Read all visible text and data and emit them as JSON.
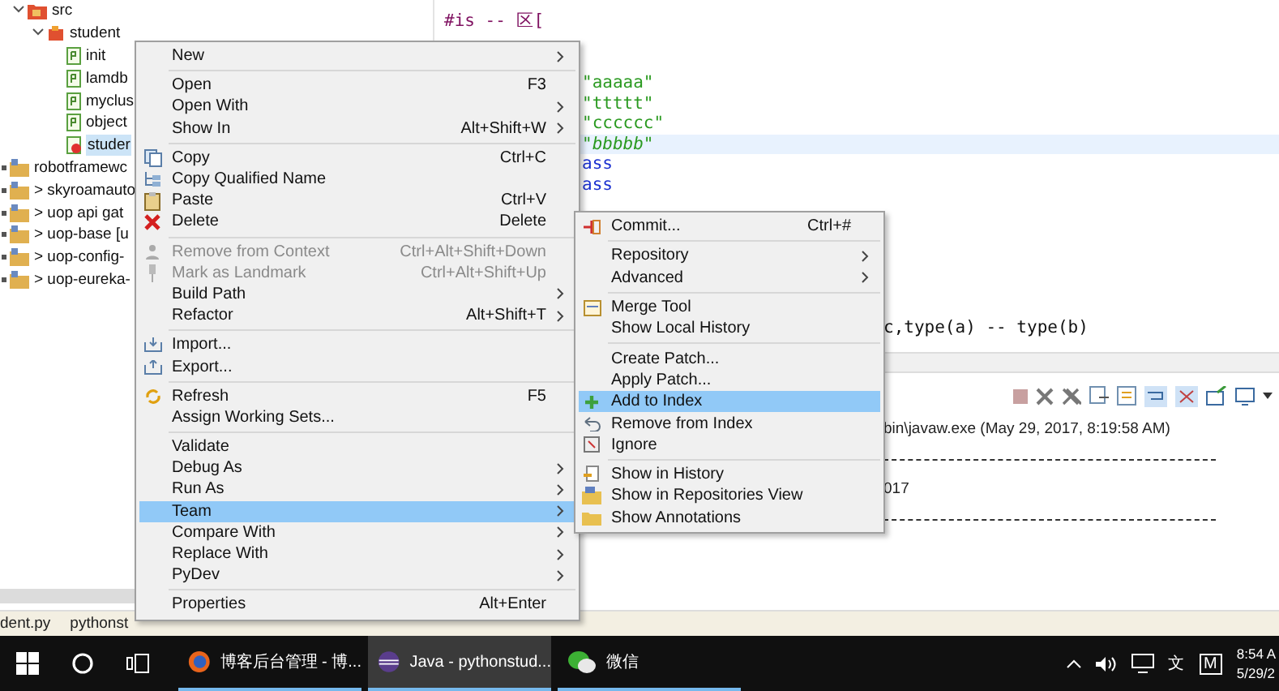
{
  "tree": {
    "items": [
      {
        "label": "src",
        "expanded": true,
        "children": [
          {
            "label": "student",
            "expanded": true,
            "selected": false,
            "children": [
              {
                "label": "init",
                "selected": false
              },
              {
                "label": "lamdb",
                "selected": false
              },
              {
                "label": "myclus",
                "selected": false
              },
              {
                "label": "object",
                "selected": false
              },
              {
                "label": "studer",
                "selected": true
              }
            ]
          }
        ]
      },
      {
        "label": "robotframewc",
        "selected": false
      },
      {
        "label": "> skyroamauto",
        "selected": false
      },
      {
        "label": "> uop api gat",
        "selected": false
      },
      {
        "label": "> uop-base [u",
        "selected": false
      },
      {
        "label": "> uop-config-",
        "selected": false
      },
      {
        "label": "> uop-eureka-",
        "selected": false
      }
    ]
  },
  "editor": {
    "lines": [
      {
        "text": "#is -- 区[",
        "kind": "comment",
        "current": false
      },
      {
        "text": "\"aaaaa\"",
        "kind": "string",
        "current": false
      },
      {
        "text": "\"ttttt\"",
        "kind": "string",
        "current": false
      },
      {
        "text": "\"cccccc\"",
        "kind": "string",
        "current": false
      },
      {
        "text": "\"bbbbb\"",
        "kind": "string",
        "current": true
      },
      {
        "text": "ass",
        "kind": "keyword",
        "current": false
      },
      {
        "text": "ass",
        "kind": "keyword",
        "current": false
      },
      {
        "text": "c,type(a) -- type(b)",
        "kind": "plain",
        "current": false
      }
    ]
  },
  "console": {
    "lines": [
      "bin\\javaw.exe (May 29, 2017, 8:19:58 AM)",
      "017"
    ]
  },
  "status_bar": {
    "items": [
      "dent.py",
      "pythonst"
    ]
  },
  "context_menu": {
    "groups": [
      [
        {
          "label": "New",
          "submenu": true,
          "disabled": false,
          "selected": false
        }
      ],
      [
        {
          "label": "Open",
          "shortcut": "F3",
          "submenu": false,
          "disabled": false,
          "selected": false
        },
        {
          "label": "Open With",
          "submenu": true,
          "disabled": false,
          "selected": false
        },
        {
          "label": "Show In",
          "shortcut": "Alt+Shift+W",
          "submenu": true,
          "disabled": false,
          "selected": false
        }
      ],
      [
        {
          "label": "Copy",
          "shortcut": "Ctrl+C",
          "submenu": false,
          "disabled": false,
          "selected": false
        },
        {
          "label": "Copy Qualified Name",
          "submenu": false,
          "disabled": false,
          "selected": false
        },
        {
          "label": "Paste",
          "shortcut": "Ctrl+V",
          "submenu": false,
          "disabled": false,
          "selected": false
        },
        {
          "label": "Delete",
          "shortcut": "Delete",
          "submenu": false,
          "disabled": false,
          "selected": false
        }
      ],
      [
        {
          "label": "Remove from Context",
          "shortcut": "Ctrl+Alt+Shift+Down",
          "submenu": false,
          "disabled": true,
          "selected": false
        },
        {
          "label": "Mark as Landmark",
          "shortcut": "Ctrl+Alt+Shift+Up",
          "submenu": false,
          "disabled": true,
          "selected": false
        },
        {
          "label": "Build Path",
          "submenu": true,
          "disabled": false,
          "selected": false
        },
        {
          "label": "Refactor",
          "shortcut": "Alt+Shift+T",
          "submenu": true,
          "disabled": false,
          "selected": false
        }
      ],
      [
        {
          "label": "Import...",
          "submenu": false,
          "disabled": false,
          "selected": false
        },
        {
          "label": "Export...",
          "submenu": false,
          "disabled": false,
          "selected": false
        }
      ],
      [
        {
          "label": "Refresh",
          "shortcut": "F5",
          "submenu": false,
          "disabled": false,
          "selected": false
        },
        {
          "label": "Assign Working Sets...",
          "submenu": false,
          "disabled": false,
          "selected": false
        }
      ],
      [
        {
          "label": "Validate",
          "submenu": false,
          "disabled": false,
          "selected": false
        },
        {
          "label": "Debug As",
          "submenu": true,
          "disabled": false,
          "selected": false
        },
        {
          "label": "Run As",
          "submenu": true,
          "disabled": false,
          "selected": false
        },
        {
          "label": "Team",
          "submenu": true,
          "disabled": false,
          "selected": true
        },
        {
          "label": "Compare With",
          "submenu": true,
          "disabled": false,
          "selected": false
        },
        {
          "label": "Replace With",
          "submenu": true,
          "disabled": false,
          "selected": false
        },
        {
          "label": "PyDev",
          "submenu": true,
          "disabled": false,
          "selected": false
        }
      ],
      [
        {
          "label": "Properties",
          "shortcut": "Alt+Enter",
          "submenu": false,
          "disabled": false,
          "selected": false
        }
      ]
    ]
  },
  "team_menu": {
    "groups": [
      [
        {
          "label": "Commit...",
          "shortcut": "Ctrl+#",
          "submenu": false,
          "selected": false
        }
      ],
      [
        {
          "label": "Repository",
          "submenu": true,
          "selected": false
        },
        {
          "label": "Advanced",
          "submenu": true,
          "selected": false
        }
      ],
      [
        {
          "label": "Merge Tool",
          "submenu": false,
          "selected": false
        },
        {
          "label": "Show Local History",
          "submenu": false,
          "selected": false
        }
      ],
      [
        {
          "label": "Create Patch...",
          "submenu": false,
          "selected": false
        },
        {
          "label": "Apply Patch...",
          "submenu": false,
          "selected": false
        },
        {
          "label": "Add to Index",
          "submenu": false,
          "selected": true
        },
        {
          "label": "Remove from Index",
          "submenu": false,
          "selected": false
        },
        {
          "label": "Ignore",
          "submenu": false,
          "selected": false
        }
      ],
      [
        {
          "label": "Show in History",
          "submenu": false,
          "selected": false
        },
        {
          "label": "Show in Repositories View",
          "submenu": false,
          "selected": false
        },
        {
          "label": "Show Annotations",
          "submenu": false,
          "selected": false
        }
      ]
    ]
  },
  "taskbar": {
    "apps": [
      {
        "label": "博客后台管理 - 博...",
        "kind": "browser",
        "active": false
      },
      {
        "label": "Java - pythonstud...",
        "kind": "ide",
        "active": true
      },
      {
        "label": "微信",
        "kind": "chat",
        "active": false
      }
    ],
    "ime": "文",
    "tray_badge": "M",
    "time": "8:54 A",
    "date": "5/29/2"
  }
}
